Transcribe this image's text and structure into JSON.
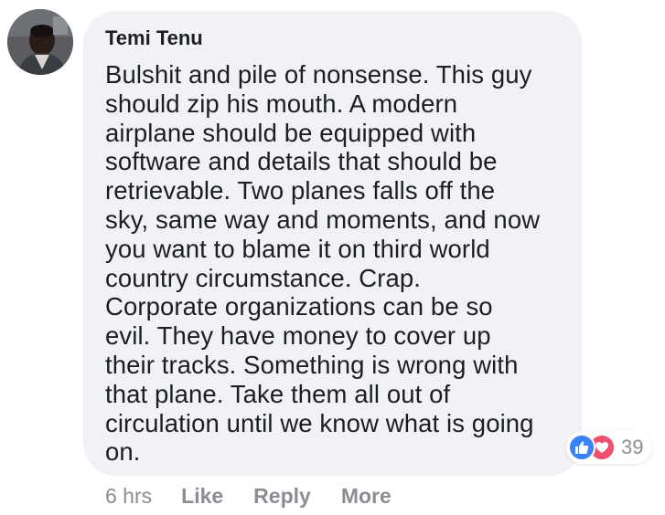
{
  "comment": {
    "author": "Temi Tenu",
    "text": "Bulshit and pile of nonsense. This guy\nshould zip his mouth. A modern\nairplane should be equipped with\nsoftware and details that should be\nretrievable. Two planes falls off the\nsky, same way and moments, and now\nyou want to blame it on third world\ncountry circumstance. Crap.\nCorporate organizations can be so\nevil. They have money to cover up\ntheir tracks. Something is wrong with\nthat plane. Take them all out of\ncirculation until we know what is going\non.",
    "reactions": {
      "count": "39",
      "types": [
        "like-icon",
        "love-icon"
      ],
      "like_color": "#3b82f6",
      "love_color": "#f0506e"
    },
    "timestamp": "6 hrs",
    "actions": {
      "like": "Like",
      "reply": "Reply",
      "more": "More"
    }
  },
  "colors": {
    "bubble_background": "#f0f2f5",
    "text": "#1c1e21",
    "meta_text": "#8a8d91"
  }
}
